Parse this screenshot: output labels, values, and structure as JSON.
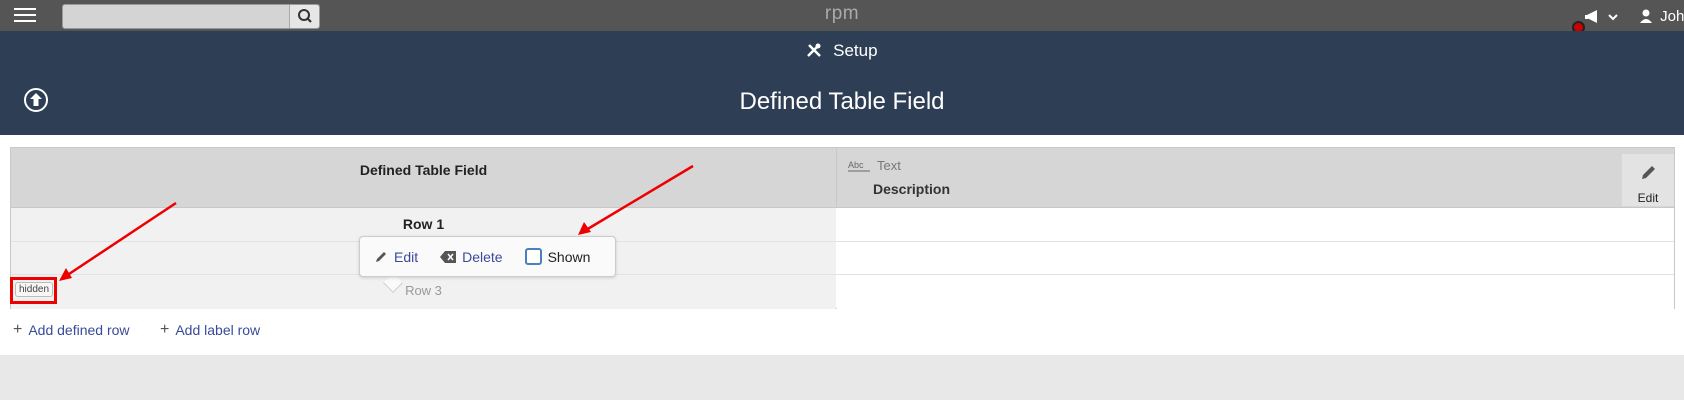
{
  "topbar": {
    "brand": "rpm",
    "search_placeholder": "",
    "user_name": "John"
  },
  "header": {
    "setup_label": "Setup",
    "page_title": "Defined Table Field"
  },
  "table": {
    "left_header": "Defined Table Field",
    "type_label": "Text",
    "type_icon_text": "Abc",
    "description_header": "Description",
    "edit_label": "Edit",
    "rows": [
      {
        "label": "Row 1"
      },
      {
        "label": ""
      },
      {
        "label": "Row 3",
        "badge": "hidden"
      }
    ]
  },
  "popup": {
    "edit": "Edit",
    "delete": "Delete",
    "shown": "Shown",
    "shown_checked": false
  },
  "actions": {
    "add_defined_row": "Add defined row",
    "add_label_row": "Add label row"
  },
  "colors": {
    "header_bg": "#2e3e55",
    "topbar_bg": "#555555",
    "link": "#3a4a9a",
    "annotation": "#e00000"
  }
}
